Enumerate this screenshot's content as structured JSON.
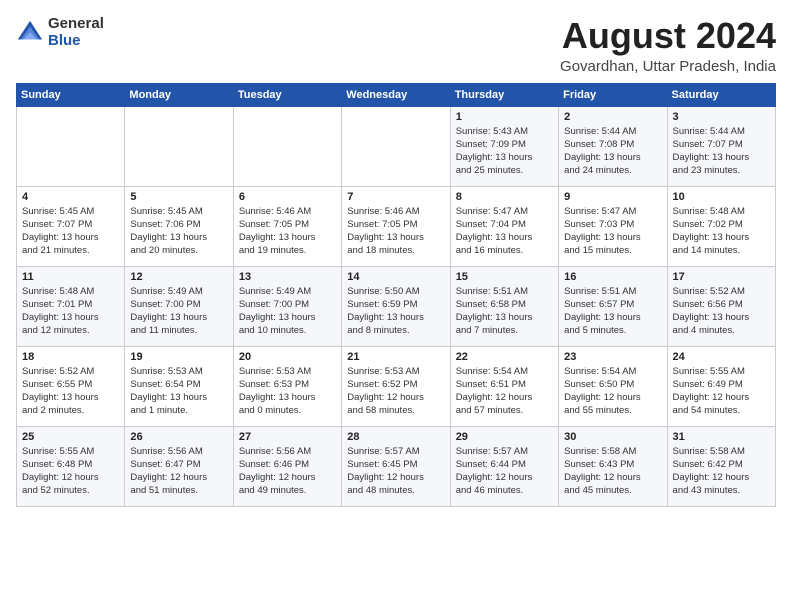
{
  "header": {
    "logo": {
      "text_general": "General",
      "text_blue": "Blue"
    },
    "title": "August 2024",
    "location": "Govardhan, Uttar Pradesh, India"
  },
  "calendar": {
    "days_of_week": [
      "Sunday",
      "Monday",
      "Tuesday",
      "Wednesday",
      "Thursday",
      "Friday",
      "Saturday"
    ],
    "weeks": [
      [
        {
          "day": "",
          "info": ""
        },
        {
          "day": "",
          "info": ""
        },
        {
          "day": "",
          "info": ""
        },
        {
          "day": "",
          "info": ""
        },
        {
          "day": "1",
          "info": "Sunrise: 5:43 AM\nSunset: 7:09 PM\nDaylight: 13 hours\nand 25 minutes."
        },
        {
          "day": "2",
          "info": "Sunrise: 5:44 AM\nSunset: 7:08 PM\nDaylight: 13 hours\nand 24 minutes."
        },
        {
          "day": "3",
          "info": "Sunrise: 5:44 AM\nSunset: 7:07 PM\nDaylight: 13 hours\nand 23 minutes."
        }
      ],
      [
        {
          "day": "4",
          "info": "Sunrise: 5:45 AM\nSunset: 7:07 PM\nDaylight: 13 hours\nand 21 minutes."
        },
        {
          "day": "5",
          "info": "Sunrise: 5:45 AM\nSunset: 7:06 PM\nDaylight: 13 hours\nand 20 minutes."
        },
        {
          "day": "6",
          "info": "Sunrise: 5:46 AM\nSunset: 7:05 PM\nDaylight: 13 hours\nand 19 minutes."
        },
        {
          "day": "7",
          "info": "Sunrise: 5:46 AM\nSunset: 7:05 PM\nDaylight: 13 hours\nand 18 minutes."
        },
        {
          "day": "8",
          "info": "Sunrise: 5:47 AM\nSunset: 7:04 PM\nDaylight: 13 hours\nand 16 minutes."
        },
        {
          "day": "9",
          "info": "Sunrise: 5:47 AM\nSunset: 7:03 PM\nDaylight: 13 hours\nand 15 minutes."
        },
        {
          "day": "10",
          "info": "Sunrise: 5:48 AM\nSunset: 7:02 PM\nDaylight: 13 hours\nand 14 minutes."
        }
      ],
      [
        {
          "day": "11",
          "info": "Sunrise: 5:48 AM\nSunset: 7:01 PM\nDaylight: 13 hours\nand 12 minutes."
        },
        {
          "day": "12",
          "info": "Sunrise: 5:49 AM\nSunset: 7:00 PM\nDaylight: 13 hours\nand 11 minutes."
        },
        {
          "day": "13",
          "info": "Sunrise: 5:49 AM\nSunset: 7:00 PM\nDaylight: 13 hours\nand 10 minutes."
        },
        {
          "day": "14",
          "info": "Sunrise: 5:50 AM\nSunset: 6:59 PM\nDaylight: 13 hours\nand 8 minutes."
        },
        {
          "day": "15",
          "info": "Sunrise: 5:51 AM\nSunset: 6:58 PM\nDaylight: 13 hours\nand 7 minutes."
        },
        {
          "day": "16",
          "info": "Sunrise: 5:51 AM\nSunset: 6:57 PM\nDaylight: 13 hours\nand 5 minutes."
        },
        {
          "day": "17",
          "info": "Sunrise: 5:52 AM\nSunset: 6:56 PM\nDaylight: 13 hours\nand 4 minutes."
        }
      ],
      [
        {
          "day": "18",
          "info": "Sunrise: 5:52 AM\nSunset: 6:55 PM\nDaylight: 13 hours\nand 2 minutes."
        },
        {
          "day": "19",
          "info": "Sunrise: 5:53 AM\nSunset: 6:54 PM\nDaylight: 13 hours\nand 1 minute."
        },
        {
          "day": "20",
          "info": "Sunrise: 5:53 AM\nSunset: 6:53 PM\nDaylight: 13 hours\nand 0 minutes."
        },
        {
          "day": "21",
          "info": "Sunrise: 5:53 AM\nSunset: 6:52 PM\nDaylight: 12 hours\nand 58 minutes."
        },
        {
          "day": "22",
          "info": "Sunrise: 5:54 AM\nSunset: 6:51 PM\nDaylight: 12 hours\nand 57 minutes."
        },
        {
          "day": "23",
          "info": "Sunrise: 5:54 AM\nSunset: 6:50 PM\nDaylight: 12 hours\nand 55 minutes."
        },
        {
          "day": "24",
          "info": "Sunrise: 5:55 AM\nSunset: 6:49 PM\nDaylight: 12 hours\nand 54 minutes."
        }
      ],
      [
        {
          "day": "25",
          "info": "Sunrise: 5:55 AM\nSunset: 6:48 PM\nDaylight: 12 hours\nand 52 minutes."
        },
        {
          "day": "26",
          "info": "Sunrise: 5:56 AM\nSunset: 6:47 PM\nDaylight: 12 hours\nand 51 minutes."
        },
        {
          "day": "27",
          "info": "Sunrise: 5:56 AM\nSunset: 6:46 PM\nDaylight: 12 hours\nand 49 minutes."
        },
        {
          "day": "28",
          "info": "Sunrise: 5:57 AM\nSunset: 6:45 PM\nDaylight: 12 hours\nand 48 minutes."
        },
        {
          "day": "29",
          "info": "Sunrise: 5:57 AM\nSunset: 6:44 PM\nDaylight: 12 hours\nand 46 minutes."
        },
        {
          "day": "30",
          "info": "Sunrise: 5:58 AM\nSunset: 6:43 PM\nDaylight: 12 hours\nand 45 minutes."
        },
        {
          "day": "31",
          "info": "Sunrise: 5:58 AM\nSunset: 6:42 PM\nDaylight: 12 hours\nand 43 minutes."
        }
      ]
    ]
  }
}
